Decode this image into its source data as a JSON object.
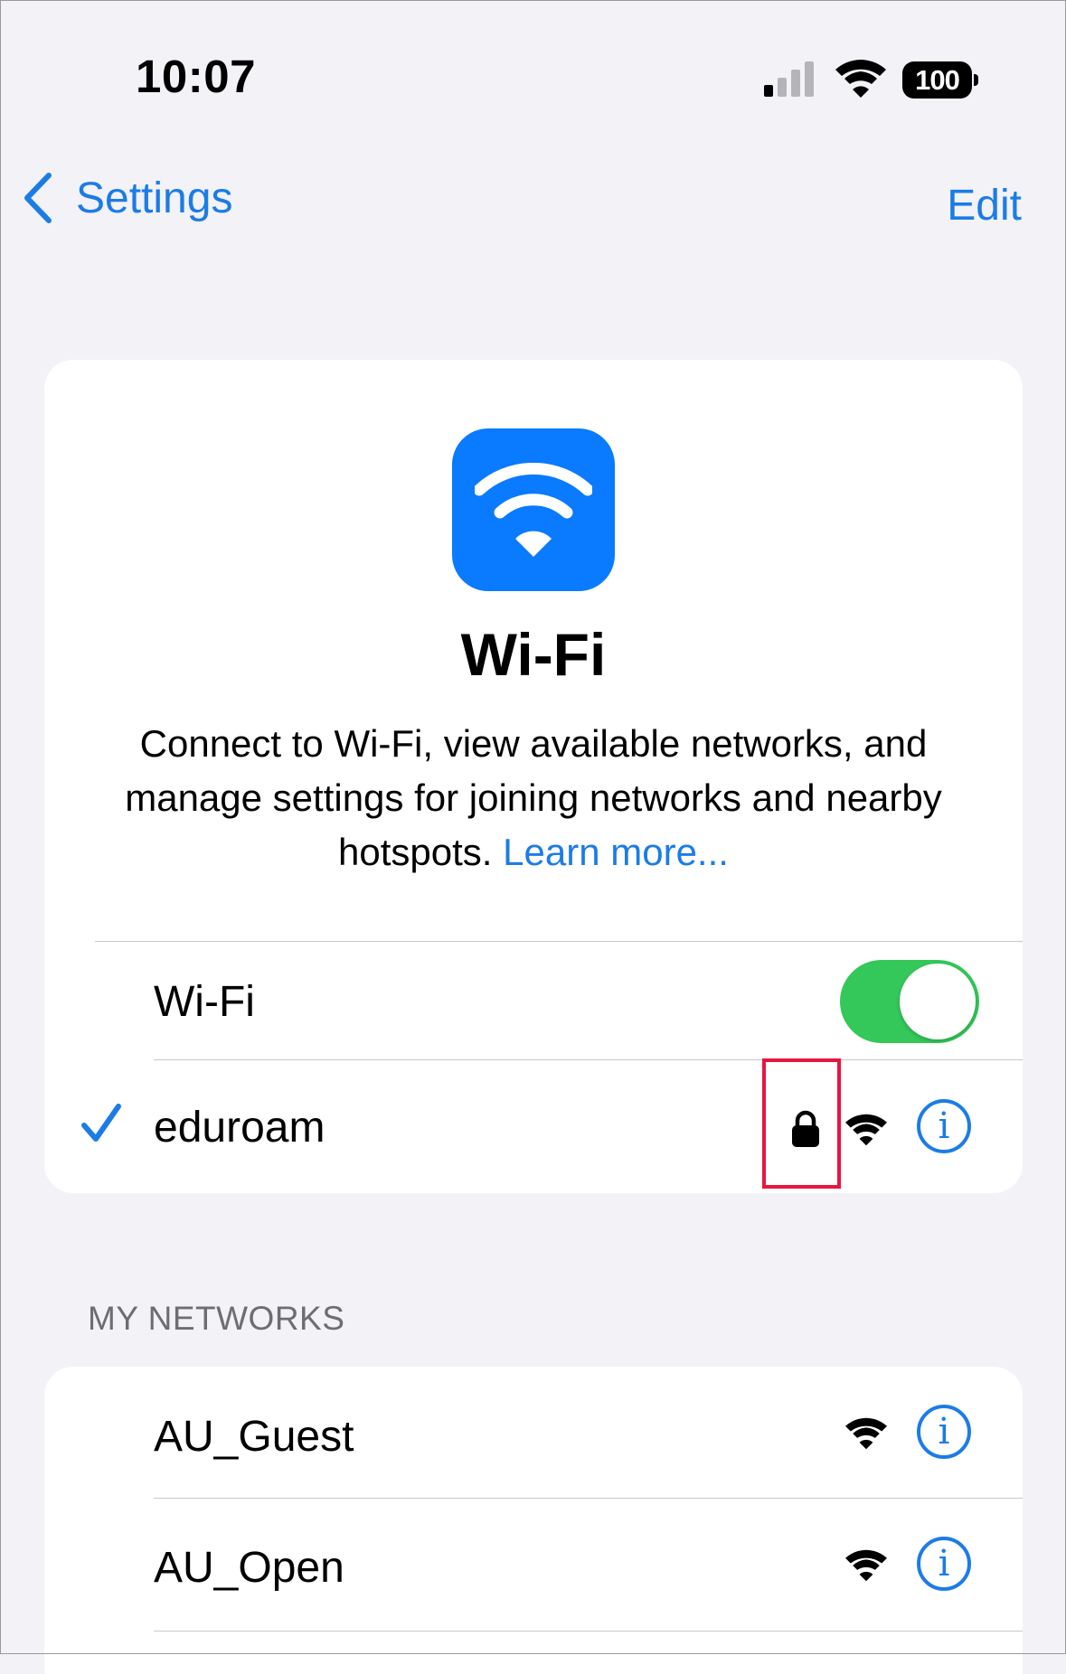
{
  "status_bar": {
    "time": "10:07",
    "battery": "100",
    "signal_icon": "cellular-signal-icon",
    "wifi_icon": "wifi-icon"
  },
  "nav": {
    "back_label": "Settings",
    "edit_label": "Edit"
  },
  "hero": {
    "title": "Wi-Fi",
    "description": "Connect to Wi-Fi, view available networks, and manage settings for joining networks and nearby hotspots.",
    "link": "Learn more..."
  },
  "wifi_toggle": {
    "label": "Wi-Fi",
    "on": true
  },
  "connected_network": {
    "name": "eduroam",
    "secured": true
  },
  "my_networks": {
    "header": "MY NETWORKS",
    "items": [
      {
        "name": "AU_Guest"
      },
      {
        "name": "AU_Open"
      }
    ]
  },
  "colors": {
    "accent": "#1c7ce6",
    "toggle_on": "#34c759",
    "highlight": "#e8163f",
    "background": "#f2f2f7"
  }
}
